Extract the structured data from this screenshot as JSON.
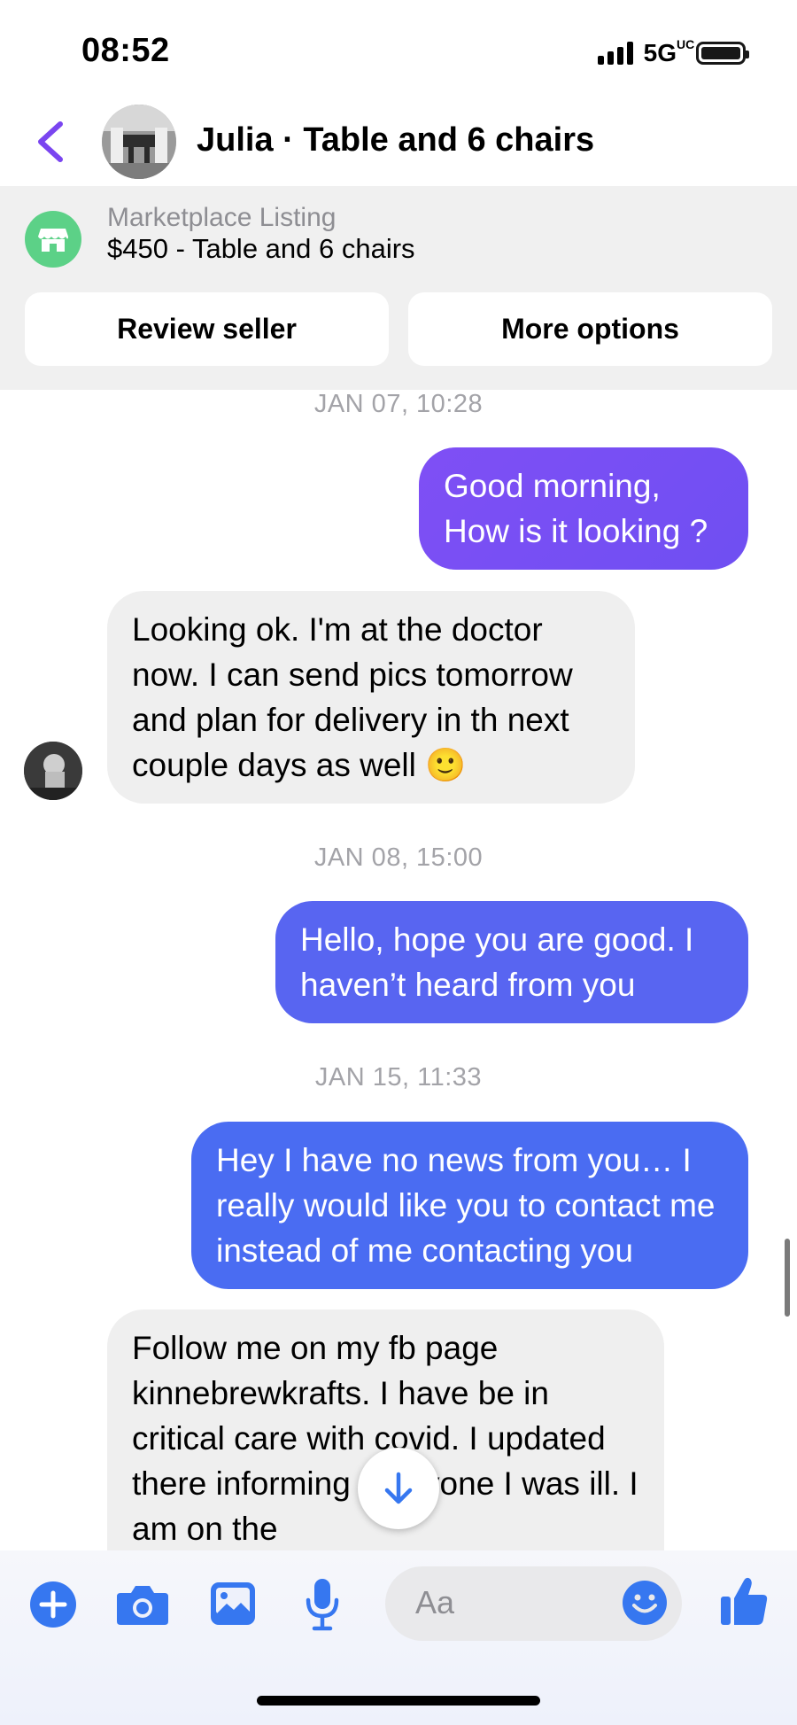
{
  "status_bar": {
    "time": "08:52",
    "network": "5G",
    "network_sub": "UC",
    "icons": [
      "signal-icon",
      "battery-icon"
    ]
  },
  "header": {
    "title": "Julia · Table and 6 chairs",
    "back_icon": "chevron-left-icon"
  },
  "listing": {
    "label": "Marketplace Listing",
    "title": "$450 - Table and 6 chairs",
    "icon": "marketplace-store-icon",
    "review_button": "Review seller",
    "more_button": "More options"
  },
  "messages": [
    {
      "type": "timestamp",
      "text": "JAN 07, 10:28"
    },
    {
      "type": "outgoing",
      "text": "Good morning,\nHow is it looking ?"
    },
    {
      "type": "incoming",
      "text": "Looking ok. I'm at the doctor now. I can send pics tomorrow and plan for delivery in th next couple days as well 🙂"
    },
    {
      "type": "timestamp",
      "text": "JAN 08, 15:00"
    },
    {
      "type": "outgoing",
      "text": "Hello, hope you are good. I haven’t heard from you"
    },
    {
      "type": "timestamp",
      "text": "JAN 15, 11:33"
    },
    {
      "type": "outgoing",
      "text": "Hey I have no news from you… I really would like you to contact me instead of me contacting you"
    },
    {
      "type": "incoming",
      "text": "Follow me on my fb page kinnebrewkrafts. I have be in critical care with covid. I updated there informing everyone I was ill. I am on the"
    }
  ],
  "composer": {
    "placeholder": "Aa",
    "icons": [
      "plus-icon",
      "camera-icon",
      "image-icon",
      "microphone-icon",
      "emoji-icon",
      "thumbs-up-icon"
    ]
  },
  "colors": {
    "accent_purple": "#7a45f0",
    "bubble_purple": "#6f4ff2",
    "bubble_indigo": "#5566f0",
    "bubble_blue": "#4a6cf2",
    "incoming_bubble": "#efefef",
    "icon_blue": "#3677f0",
    "marketplace_green": "#5cd187"
  }
}
